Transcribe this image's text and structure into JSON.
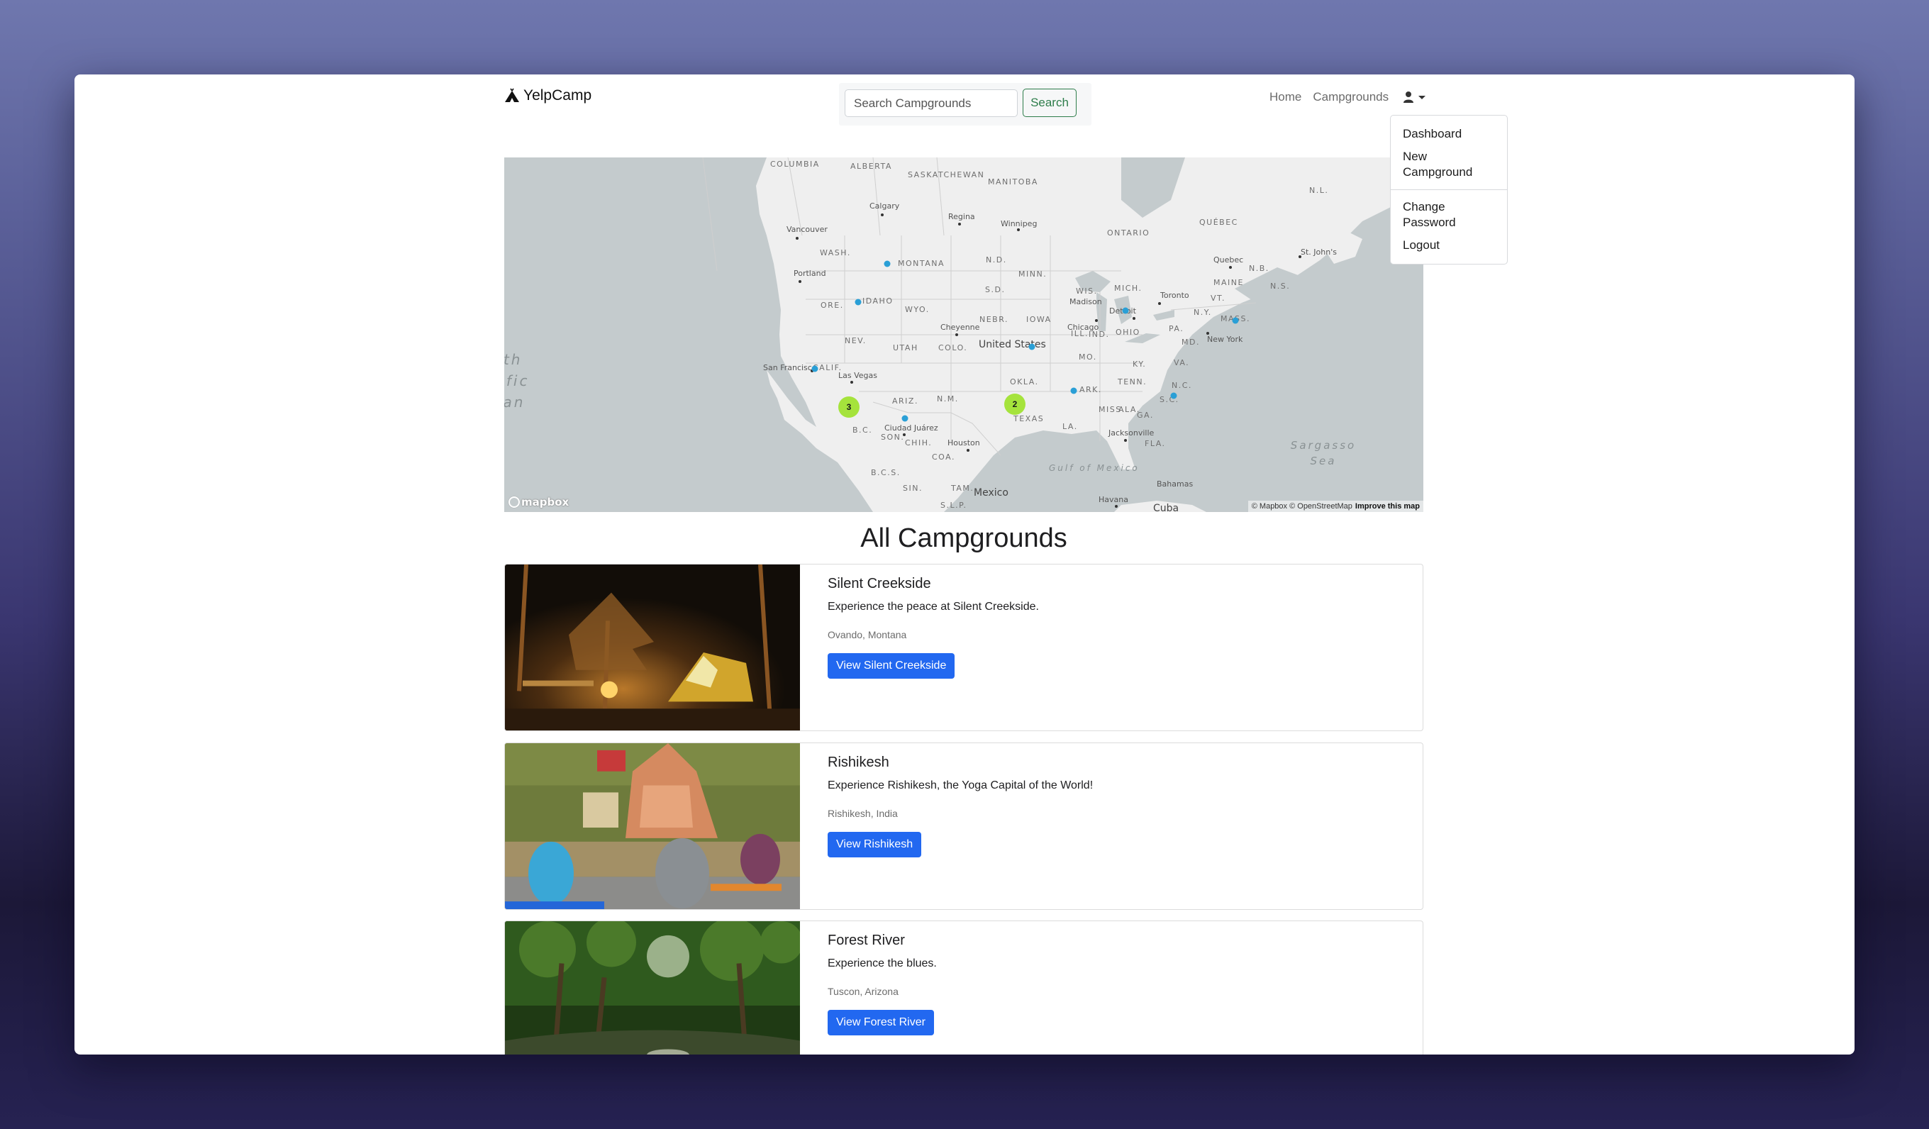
{
  "navbar": {
    "brand": "YelpCamp",
    "brand_icon": "campground-icon",
    "search": {
      "placeholder": "Search Campgrounds",
      "value": "",
      "button_label": "Search"
    },
    "links": [
      {
        "label": "Home"
      },
      {
        "label": "Campgrounds"
      }
    ],
    "user_menu": {
      "icon": "user-icon",
      "expanded": true,
      "items": [
        {
          "label": "Dashboard"
        },
        {
          "label": "New Campground"
        },
        {
          "label": "Change Password"
        },
        {
          "label": "Logout"
        }
      ]
    }
  },
  "map": {
    "provider": "mapbox",
    "logo_text": "mapbox",
    "attribution": "© Mapbox © OpenStreetMap",
    "improve_link": "Improve this map",
    "clusters": [
      {
        "count": "3",
        "near": "Southern California"
      },
      {
        "count": "2",
        "near": "Oklahoma/Texas"
      }
    ],
    "marker_color": "#2a9fd6",
    "cluster_color": "#a5e33c",
    "labels": {
      "regions": [
        "COLUMBIA",
        "ALBERTA",
        "SASKATCHEWAN",
        "MANITOBA",
        "ONTARIO",
        "QUÉBEC",
        "N.L.",
        "N.B.",
        "N.S.",
        "WASH.",
        "MONTANA",
        "N.D.",
        "MINN.",
        "ORE.",
        "IDAHO",
        "WYO.",
        "S.D.",
        "WIS.",
        "MICH.",
        "N.Y.",
        "MAINE",
        "VT.",
        "MASS.",
        "NEV.",
        "UTAH",
        "COLO.",
        "NEBR.",
        "IOWA",
        "ILL.",
        "IND.",
        "OHIO",
        "PA.",
        "MD.",
        "CALIF.",
        "ARIZ.",
        "N.M.",
        "OKLA.",
        "MO.",
        "KY.",
        "VA.",
        "TENN.",
        "N.C.",
        "ARK.",
        "S.C.",
        "MISS.",
        "ALA.",
        "GA.",
        "TEXAS",
        "LA.",
        "FLA.",
        "B.C.",
        "SON.",
        "CHIH.",
        "COA.",
        "B.C.S.",
        "SIN.",
        "TAM.",
        "S.L.P."
      ],
      "cities": [
        "Calgary",
        "Regina",
        "Winnipeg",
        "Vancouver",
        "Portland",
        "Quebec",
        "St. John's",
        "Toronto",
        "Madison",
        "Detroit",
        "Chicago",
        "New York",
        "Cheyenne",
        "San Francisco",
        "Las Vegas",
        "Ciudad Juárez",
        "Houston",
        "Jacksonville",
        "Havana",
        "Bahamas"
      ],
      "countries": [
        "United States",
        "Mexico",
        "Cuba"
      ],
      "water": [
        "Gulf of Mexico",
        "Sargasso Sea",
        "North Pacific Ocean"
      ]
    }
  },
  "main": {
    "title": "All Campgrounds",
    "campgrounds": [
      {
        "title": "Silent Creekside",
        "description": "Experience the peace at Silent Creekside.",
        "location": "Ovando, Montana",
        "button_label": "View Silent Creekside",
        "image": "tent-at-night-forest"
      },
      {
        "title": "Rishikesh",
        "description": "Experience Rishikesh, the Yoga Capital of the World!",
        "location": "Rishikesh, India",
        "button_label": "View Rishikesh",
        "image": "yoga-by-river-temple"
      },
      {
        "title": "Forest River",
        "description": "Experience the blues.",
        "location": "Tuscon, Arizona",
        "button_label": "View Forest River",
        "image": "forest-river"
      }
    ]
  },
  "colors": {
    "primary_button": "#2268f0",
    "search_button": "#2e7d4b",
    "map_water": "#c4cbcd",
    "map_land": "#efefef"
  }
}
